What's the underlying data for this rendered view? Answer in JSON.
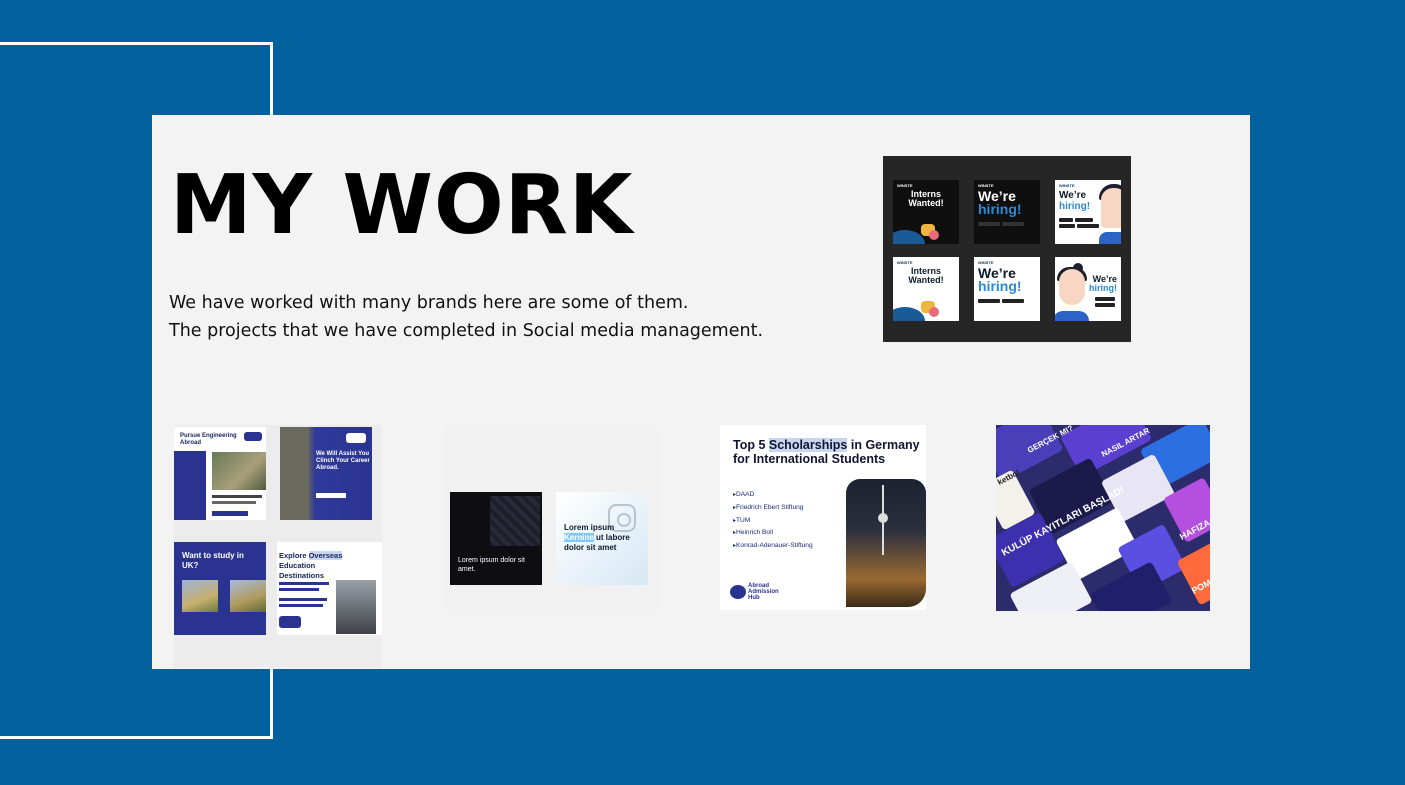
{
  "slide": {
    "title": "MY WORK",
    "description_line1": "We have worked with many brands here are some of them.",
    "description_line2": "The projects that we have completed in Social media management."
  },
  "hiring_grid": {
    "tiles": [
      {
        "brand": "WINSTE",
        "headline": "Interns Wanted!"
      },
      {
        "brand": "WINSTE",
        "headline_a": "We’re",
        "headline_b": "hiring!"
      },
      {
        "brand": "WINSTE",
        "headline_a": "We’re",
        "headline_b": "hiring!"
      },
      {
        "brand": "WINSTE",
        "headline": "Interns Wanted!"
      },
      {
        "brand": "WINSTE",
        "headline_a": "We’re",
        "headline_b": "hiring!"
      },
      {
        "headline_a": "We’re",
        "headline_b": "hiring!"
      }
    ]
  },
  "thumb_engineering": {
    "card1_title": "Pursue Engineering Abroad",
    "card2_title": "We Will Assist You Clinch Your Career Abroad.",
    "card3_title": "Want to study in UK?",
    "card4_title_a": "Explore ",
    "card4_title_hl": "Overseas",
    "card4_title_b": " Education Destinations"
  },
  "thumb_lorem": {
    "dark_text": "Lorem ipsum dolor sit amet.",
    "light_text_a": "Lorem ipsum ",
    "light_text_hl": "Kernine",
    "light_text_b": " ut labore dolor sit amet"
  },
  "thumb_scholarships": {
    "title_a": "Top 5 ",
    "title_hl": "Scholarships",
    "title_b": " in Germany  for International Students",
    "items": [
      "DAAD",
      "Friedrich Ebert Stiftung",
      "TUM",
      "Heinrich Boll",
      "Konrad-Adenauer-Stiftung"
    ],
    "logo_text": "Abroad Admission Hub"
  },
  "thumb_collage": {
    "texts": [
      "GERÇEK MI?",
      "NASIL ARTAR",
      "ketbol",
      "KULÜP KAYITLARI BAŞLADI",
      "HAFIZA SARAYI TEKNİĞİ",
      "POMO TEK"
    ]
  },
  "colors": {
    "background": "#02609c",
    "panel": "#f3f3f3",
    "accent_blue": "#2a3390"
  }
}
